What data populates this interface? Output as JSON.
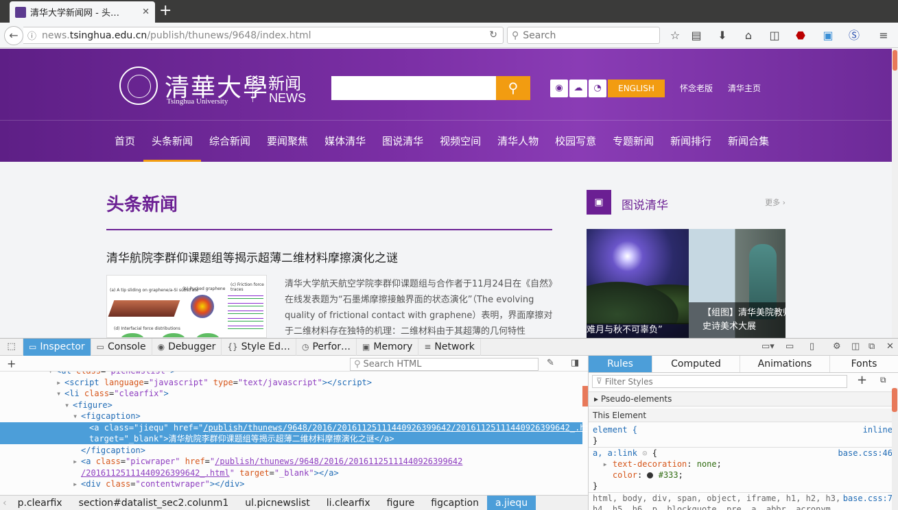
{
  "browser": {
    "tab_title": "清华大学新闻网 - 头…",
    "url_prefix": "news.",
    "url_domain": "tsinghua.edu.cn",
    "url_path": "/publish/thunews/9648/index.html",
    "search_placeholder": "Search"
  },
  "site": {
    "brand_cn": "清華大學",
    "brand_en": "Tsinghua University",
    "news_cn": "新闻",
    "news_en": "NEWS",
    "english_label": "ENGLISH",
    "old_version": "怀念老版",
    "homepage": "清华主页",
    "menu": [
      "首页",
      "头条新闻",
      "综合新闻",
      "要闻聚焦",
      "媒体清华",
      "图说清华",
      "视频空间",
      "清华人物",
      "校园写意",
      "专题新闻",
      "新闻排行",
      "新闻合集"
    ],
    "active_menu": "头条新闻",
    "section_title": "头条新闻",
    "article_title": "清华航院李群仰课题组等揭示超薄二维材料摩擦演化之谜",
    "article_text": "清华大学航天航空学院李群仰课题组与合作者于11月24日在《自然》在线发表题为“石墨烯摩擦接触界面的状态演化”（The evolving quality of frictional contact with graphene）表明，界面摩擦对于二维材料存在独特的机理：二维材料由于其超薄的几何特性",
    "figure_labels": [
      "(a) A tip sliding on graphene/a-Si substrate",
      "(b) Pucked graphene",
      "(c) Friction force traces",
      "(d) Interfacial force distributions"
    ],
    "side_title": "图说清华",
    "side_more": "更多 ›",
    "photo1_caption": "难月与秋不可辜负”",
    "photo2_caption_1": "【组图】清华美院教师",
    "photo2_caption_2": "史诗美术大展"
  },
  "devtools": {
    "tabs": [
      {
        "icon": "▭",
        "label": "Inspector"
      },
      {
        "icon": "▭",
        "label": "Console"
      },
      {
        "icon": "◉",
        "label": "Debugger"
      },
      {
        "icon": "{}",
        "label": "Style Ed…"
      },
      {
        "icon": "◷",
        "label": "Perfor…"
      },
      {
        "icon": "▣",
        "label": "Memory"
      },
      {
        "icon": "≡",
        "label": "Network"
      }
    ],
    "search_html_placeholder": "Search HTML",
    "markup_lines": [
      {
        "indent": 6,
        "tw": "▾",
        "html": "<span class='tg'>&lt;ul</span> <span class='at'>class</span>=<span class='av'>\"picnewslist\"</span><span class='tg'>&gt;</span>",
        "cls": "cut"
      },
      {
        "indent": 7,
        "tw": "▸",
        "html": "<span class='tg'>&lt;script</span> <span class='at'>language</span>=<span class='av'>\"javascript\"</span> <span class='at'>type</span>=<span class='av'>\"text/javascript\"</span><span class='tg'>&gt;&lt;/script&gt;</span>"
      },
      {
        "indent": 7,
        "tw": "▾",
        "html": "<span class='tg'>&lt;li</span> <span class='at'>class</span>=<span class='av'>\"clearfix\"</span><span class='tg'>&gt;</span>"
      },
      {
        "indent": 8,
        "tw": "▾",
        "html": "<span class='tg'>&lt;figure&gt;</span>"
      },
      {
        "indent": 9,
        "tw": "▾",
        "html": "<span class='tg'>&lt;figcaption&gt;</span>"
      },
      {
        "indent": 10,
        "tw": "",
        "html": "<span class='tg'>&lt;a</span> <span class='at'>class</span>=<span class='av'>\"jiequ\"</span> <span class='at'>href</span>=<span class='av'>\"<u>/publish/thunews/9648/2016/20161125111440926399642/20161125111440926399642_.html</u>\"</span>",
        "sel": true
      },
      {
        "indent": 10,
        "tw": "",
        "html": "<span class='at'>target</span>=<span class='av'>\"_blank\"</span><span class='tg'>&gt;</span>清华航院李群仰课题组等揭示超薄二维材料摩擦演化之谜<span class='tg'>&lt;/a&gt;</span>",
        "sel": true
      },
      {
        "indent": 9,
        "tw": "",
        "html": "<span class='tg'>&lt;/figcaption&gt;</span>"
      },
      {
        "indent": 9,
        "tw": "▸",
        "html": "<span class='tg'>&lt;a</span> <span class='at'>class</span>=<span class='av'>\"picwraper\"</span> <span class='at'>href</span>=<span class='av'>\"<u>/publish/thunews/9648/2016/20161125111440926399642</u></span>"
      },
      {
        "indent": 9,
        "tw": "",
        "html": "<span class='av'><u>/20161125111440926399642_.html</u>\"</span> <span class='at'>target</span>=<span class='av'>\"_blank\"</span><span class='tg'>&gt;&lt;/a&gt;</span>"
      },
      {
        "indent": 9,
        "tw": "▸",
        "html": "<span class='tg'>&lt;div</span> <span class='at'>class</span>=<span class='av'>\"contentwraper\"</span><span class='tg'>&gt;&lt;/div&gt;</span>"
      },
      {
        "indent": 9,
        "tw": "",
        "html": "<span class='tg'>&lt;/figure&gt;</span>"
      }
    ],
    "breadcrumbs": [
      "p.clearfix",
      "section#datalist_sec2.colunm1",
      "ul.picnewslist",
      "li.clearfix",
      "figure",
      "figcaption",
      "a.jiequ"
    ],
    "side_tabs": [
      "Rules",
      "Computed",
      "Animations",
      "Fonts"
    ],
    "filter_placeholder": "Filter Styles",
    "pseudo_elements": "Pseudo-elements",
    "this_element": "This Element",
    "rule_element_selector": "element {",
    "rule_inline": "inline",
    "rule_close": "}",
    "rule2_selector": "a, a:link",
    "rule2_source": "base.css:46",
    "rule2_prop1": "text-decoration",
    "rule2_val1": "none",
    "rule2_prop2": "color",
    "rule2_val2": "#333",
    "rule3_line1": "html, body, div, span, object, iframe, h1, h2, h3,",
    "rule3_line2": "h4, h5, h6, p, blockquote, pre, a, abbr, acronym,",
    "rule3_source": "base.css:7"
  }
}
